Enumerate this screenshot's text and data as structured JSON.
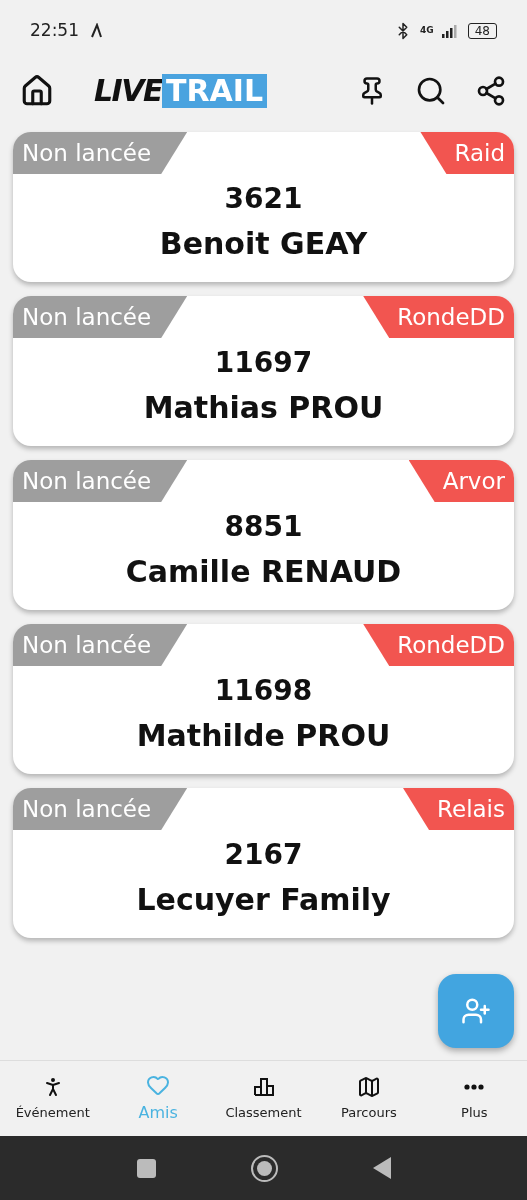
{
  "status_bar": {
    "time": "22:51",
    "network": "4G",
    "battery": "48"
  },
  "header": {
    "logo_left": "LIVE",
    "logo_right": "TRAIL"
  },
  "friends": [
    {
      "status": "Non lancée",
      "race": "Raid",
      "bib": "3621",
      "name": "Benoit GEAY"
    },
    {
      "status": "Non lancée",
      "race": "RondeDD",
      "bib": "11697",
      "name": "Mathias PROU"
    },
    {
      "status": "Non lancée",
      "race": "Arvor",
      "bib": "8851",
      "name": "Camille RENAUD"
    },
    {
      "status": "Non lancée",
      "race": "RondeDD",
      "bib": "11698",
      "name": "Mathilde PROU"
    },
    {
      "status": "Non lancée",
      "race": "Relais",
      "bib": "2167",
      "name": "Lecuyer Family"
    }
  ],
  "bottom_nav": [
    {
      "kind": "event",
      "label": "Événement",
      "selected": false
    },
    {
      "kind": "friends",
      "label": "Amis",
      "selected": true
    },
    {
      "kind": "ranking",
      "label": "Classement",
      "selected": false
    },
    {
      "kind": "routes",
      "label": "Parcours",
      "selected": false
    },
    {
      "kind": "more",
      "label": "Plus",
      "selected": false
    }
  ]
}
